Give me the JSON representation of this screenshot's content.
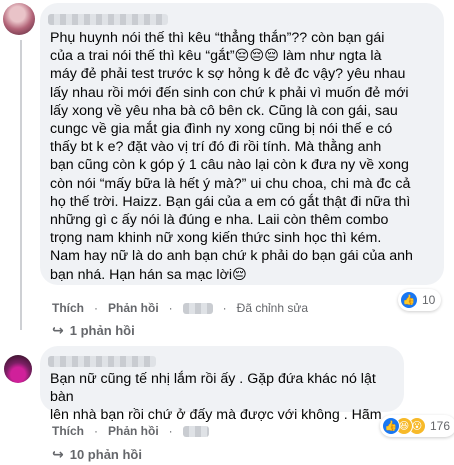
{
  "comment1": {
    "text": "Phụ huynh nói thế thì kêu “thẳng thắn”?? còn bạn gái\ncủa a trai nói thế thì kêu “gắt”😔😔😔 làm như ngta là\nmáy đẻ phải test trước k sợ hỏng k đẻ đc vậy? yêu nhau\nlấy nhau rồi mới đến sinh con chứ k phải vì muốn đẻ mới\nlấy xong về yêu nha bà cô bên ck. Cũng là con gái, sau\ncungc về gia mắt gia đình ny xong cũng bị nói thế e có\nthấy bt k e? đặt vào vị trí đó đi rồi tính. Mà thằng anh\nbạn cũng còn k góp ý 1 câu nào lại còn k đưa ny về xong\ncòn nói “mấy bữa là hết ý mà?” ui chu choa, chi mà đc cả\nhọ thế trời. Haizz. Bạn gái của a em có gắt thật đi nữa thì\nnhững gì c ấy nói là đúng e nha. Laii còn thêm combo\ntrọng nam khinh nữ xong kiến thức sinh học thì kém.\nNam hay nữ là do anh bạn chứ k phải do bạn gái của anh\nbạn nhá. Hạn hán sa mạc lời😔",
    "actions": {
      "like": "Thích",
      "reply": "Phản hồi",
      "time": "",
      "edited": "Đã chỉnh sửa"
    },
    "reaction_count": "10",
    "replies_label": "1 phản hồi"
  },
  "comment2": {
    "text": "Bạn nữ cũng tế nhị lắm rồi ấy . Gặp đứa khác nó lật bàn\nlên nhà bạn rồi chứ ở đấy mà được với không . Hãm",
    "actions": {
      "like": "Thích",
      "reply": "Phản hồi"
    },
    "reaction_count": "176",
    "replies_label": "10 phản hồi"
  },
  "icons": {
    "like": "like-icon",
    "haha": "haha-icon",
    "wow": "wow-icon",
    "reply_arrow": "reply-arrow-icon"
  },
  "colors": {
    "like_blue": "#1877f2",
    "bubble": "#f0f2f5",
    "muted": "#65676b"
  }
}
